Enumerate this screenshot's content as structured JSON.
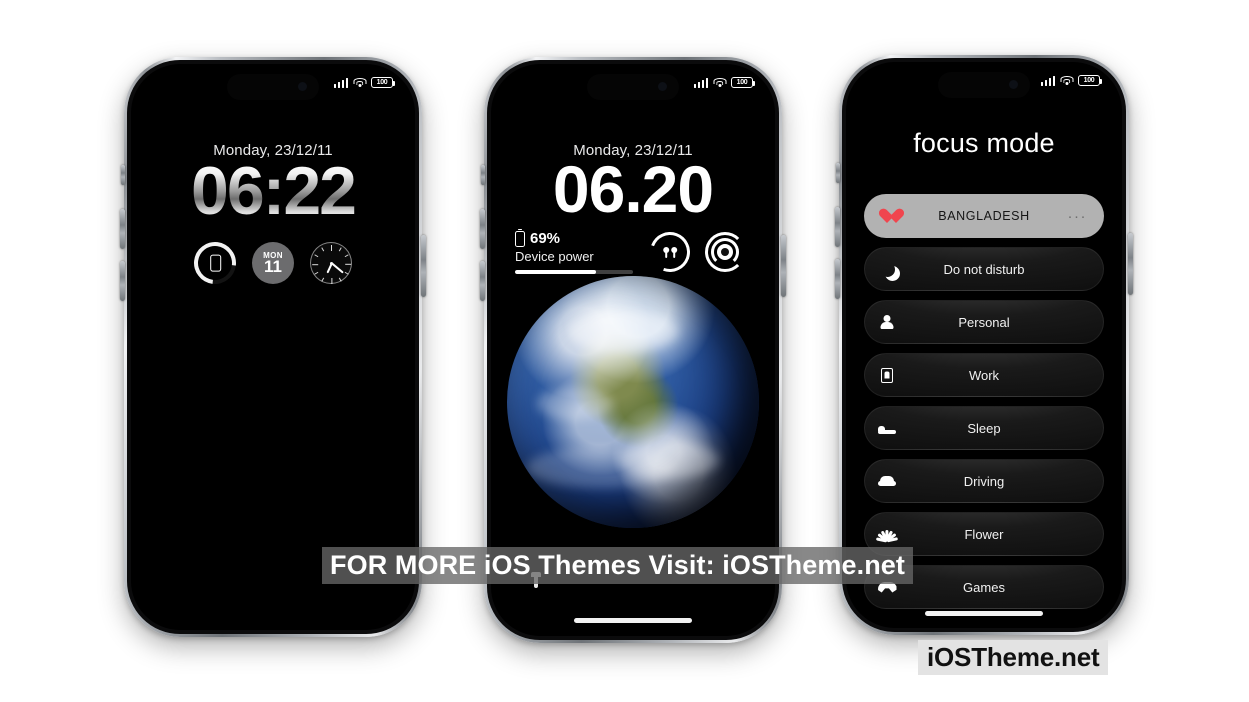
{
  "page": {
    "background_color": "#ffffff",
    "accent_color": "#f0454e",
    "active_pill_color": "#b2b2b2"
  },
  "watermark": {
    "banner_text": "FOR MORE iOS Themes Visit: iOSTheme.net",
    "logo_text": "iOSTheme.net"
  },
  "status_bar": {
    "signal_icon": "cellular-signal-icon",
    "wifi_icon": "wifi-icon",
    "battery_icon": "battery-icon",
    "battery_text": "100"
  },
  "phone1": {
    "name": "lock-screen-minimal",
    "date": "Monday, 23/12/11",
    "time": "06:22",
    "widgets": [
      {
        "name": "battery-ring-widget",
        "icon": "phone-battery-ring-icon",
        "label": ""
      },
      {
        "name": "calendar-widget",
        "icon": "calendar-icon",
        "weekday": "MON",
        "day": "11"
      },
      {
        "name": "analog-clock-widget",
        "icon": "analog-clock-icon",
        "label": ""
      }
    ]
  },
  "phone2": {
    "name": "lock-screen-earth",
    "date": "Monday, 23/12/11",
    "time": "06.20",
    "device_power": {
      "percent_text": "69%",
      "label": "Device power",
      "fill_percent": 69,
      "icon": "battery-vertical-icon"
    },
    "widgets": [
      {
        "name": "airpods-widget",
        "icon": "airpods-icon"
      },
      {
        "name": "rings-widget",
        "icon": "concentric-rings-icon"
      }
    ],
    "wallpaper": "earth-globe",
    "bottom_controls": [
      {
        "name": "flashlight-button",
        "icon": "flashlight-icon"
      },
      {
        "name": "camera-button",
        "icon": "camera-icon"
      }
    ]
  },
  "phone3": {
    "name": "focus-mode-screen",
    "title": "focus mode",
    "rows": [
      {
        "label": "BANGLADESH",
        "icon": "heart-icon",
        "active": true,
        "menu": "···"
      },
      {
        "label": "Do not disturb",
        "icon": "moon-icon",
        "active": false
      },
      {
        "label": "Personal",
        "icon": "person-icon",
        "active": false
      },
      {
        "label": "Work",
        "icon": "briefcase-icon",
        "active": false
      },
      {
        "label": "Sleep",
        "icon": "bed-icon",
        "active": false
      },
      {
        "label": "Driving",
        "icon": "car-icon",
        "active": false
      },
      {
        "label": "Flower",
        "icon": "flower-icon",
        "active": false
      },
      {
        "label": "Games",
        "icon": "gamepad-icon",
        "active": false
      }
    ]
  }
}
